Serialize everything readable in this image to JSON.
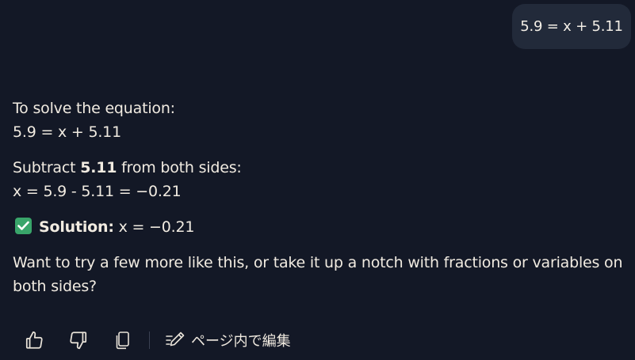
{
  "user_message": "5.9 = x + 5.11",
  "response": {
    "intro": "To solve the equation:",
    "equation": "5.9 = x + 5.11",
    "step_prefix": "Subtract ",
    "step_value": "5.11",
    "step_suffix": " from both sides:",
    "step_calc": "x = 5.9 - 5.11 = −0.21",
    "solution_label": "Solution:",
    "solution_value": " x = −0.21",
    "followup": "Want to try a few more like this, or take it up a notch with fractions or variables on both sides?"
  },
  "toolbar": {
    "edit_label": "ページ内で編集",
    "icons": [
      "thumbs-up-icon",
      "thumbs-down-icon",
      "copy-icon",
      "edit-icon"
    ]
  },
  "colors": {
    "background": "#131826",
    "bubble": "#222a3a",
    "text": "#f1ebe1",
    "check_green": "#39a56a"
  }
}
